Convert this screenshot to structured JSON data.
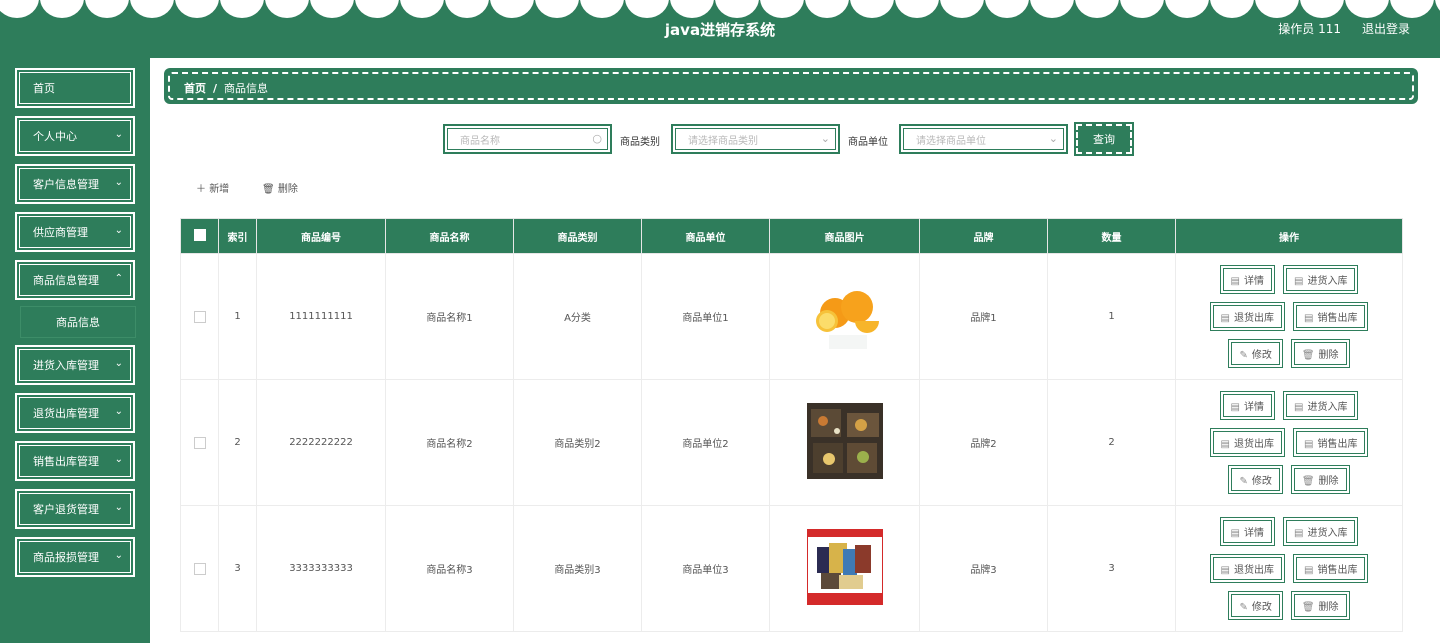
{
  "header": {
    "title": "java进销存系统",
    "user": "操作员 111",
    "logout": "退出登录"
  },
  "sidebar": {
    "items": [
      {
        "label": "首页",
        "chevron": false
      },
      {
        "label": "个人中心",
        "chevron": true
      },
      {
        "label": "客户信息管理",
        "chevron": true
      },
      {
        "label": "供应商管理",
        "chevron": true
      },
      {
        "label": "商品信息管理",
        "chevron": true
      },
      {
        "label": "进货入库管理",
        "chevron": true
      },
      {
        "label": "退货出库管理",
        "chevron": true
      },
      {
        "label": "销售出库管理",
        "chevron": true
      },
      {
        "label": "客户退货管理",
        "chevron": true
      },
      {
        "label": "商品报损管理",
        "chevron": true
      }
    ],
    "subitem": "商品信息"
  },
  "breadcrumb": {
    "home": "首页",
    "sep": "/",
    "current": "商品信息"
  },
  "search": {
    "name_placeholder": "商品名称",
    "category_label": "商品类别",
    "category_placeholder": "请选择商品类别",
    "unit_label": "商品单位",
    "unit_placeholder": "请选择商品单位",
    "query": "查询"
  },
  "toolbar": {
    "add": "新增",
    "delete": "删除"
  },
  "table": {
    "headers": [
      "索引",
      "商品编号",
      "商品名称",
      "商品类别",
      "商品单位",
      "商品图片",
      "品牌",
      "数量",
      "操作"
    ],
    "rows": [
      {
        "index": "1",
        "code": "1111111111",
        "name": "商品名称1",
        "category": "A分类",
        "unit": "商品单位1",
        "image": "oranges",
        "brand": "品牌1",
        "qty": "1"
      },
      {
        "index": "2",
        "code": "2222222222",
        "name": "商品名称2",
        "category": "商品类别2",
        "unit": "商品单位2",
        "image": "food-boxes",
        "brand": "品牌2",
        "qty": "2"
      },
      {
        "index": "3",
        "code": "3333333333",
        "name": "商品名称3",
        "category": "商品类别3",
        "unit": "商品单位3",
        "image": "snacks-pack",
        "brand": "品牌3",
        "qty": "3"
      }
    ],
    "actions": [
      "详情",
      "进货入库",
      "退货出库",
      "销售出库",
      "修改",
      "删除"
    ]
  },
  "colors": {
    "primary": "#2e7d5b"
  }
}
